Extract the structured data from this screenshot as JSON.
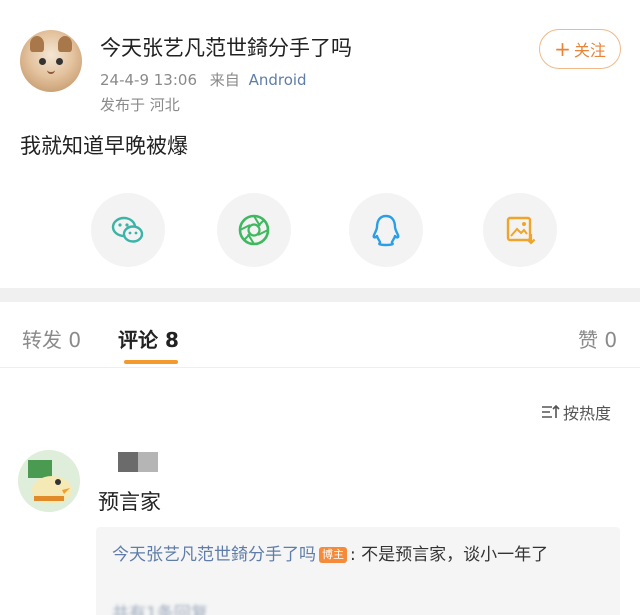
{
  "post": {
    "username": "今天张艺凡范世錡分手了吗",
    "timestamp": "24-4-9 13:06",
    "from_prefix": "来自",
    "source": "Android",
    "location": "发布于 河北",
    "follow_label": "关注",
    "content": "我就知道早晚被爆",
    "share_icons": [
      "wechat-icon",
      "moments-icon",
      "qq-icon",
      "save-image-icon"
    ]
  },
  "tabs": {
    "repost": "转发 0",
    "comments": "评论 8",
    "likes": "赞 0"
  },
  "sort": {
    "label": "按热度"
  },
  "comment": {
    "text": "预言家",
    "reply": {
      "author": "今天张艺凡范世錡分手了吗",
      "badge": "博主",
      "text": ": 不是预言家，谈小一年了",
      "more": "共有1条回复"
    }
  },
  "colors": {
    "accent": "#f49a2c",
    "follow": "#e8833a",
    "link": "#5f7da8",
    "wechat": "#3bb4a7",
    "moments": "#3fb85f",
    "qq": "#2b9ee8",
    "save": "#f0a52a"
  }
}
